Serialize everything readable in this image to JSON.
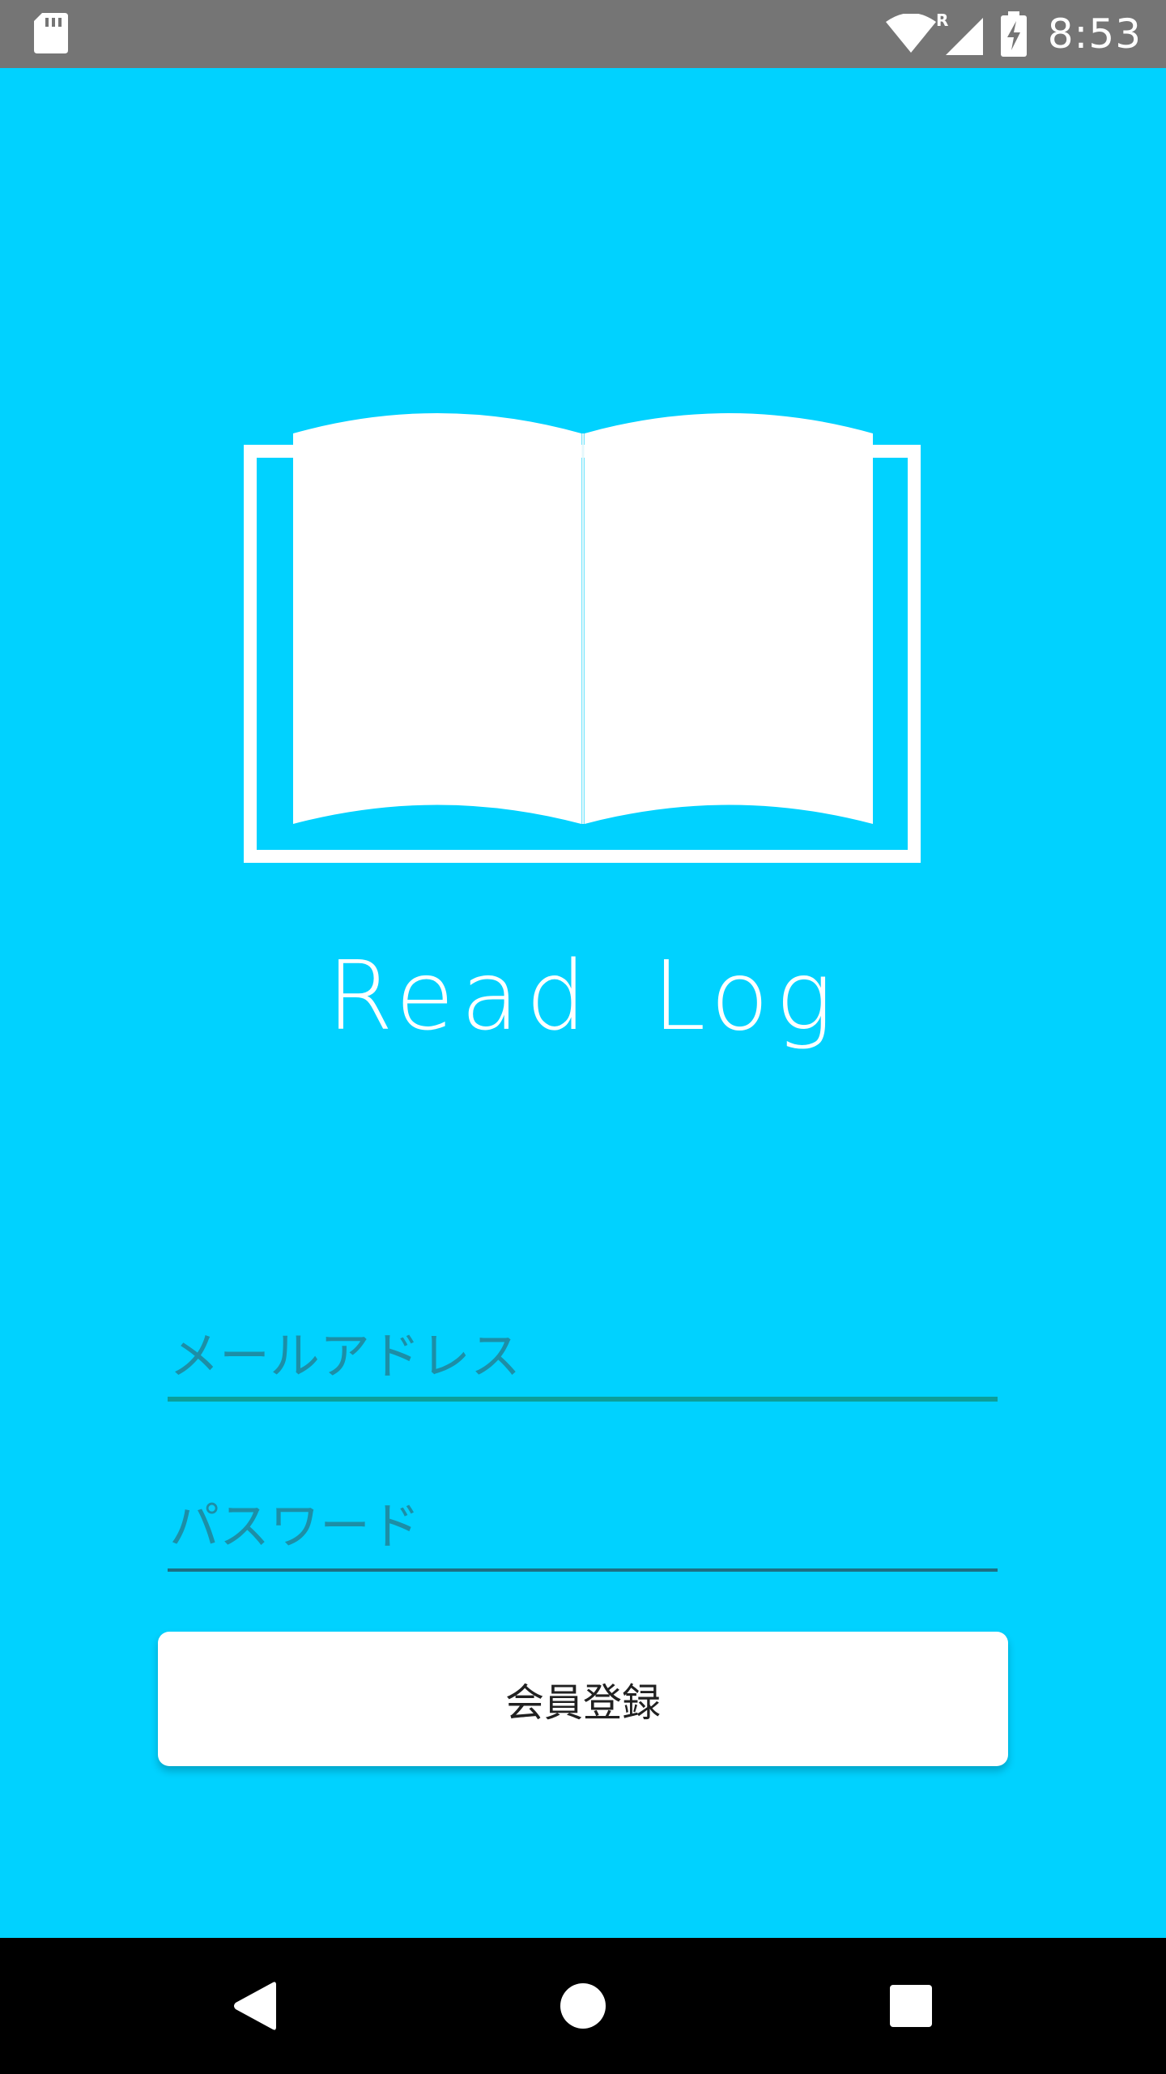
{
  "status_bar": {
    "time": "8:53",
    "roaming_label": "R",
    "icons": [
      "sd-card-icon",
      "wifi-icon",
      "cellular-signal-icon",
      "battery-charging-icon"
    ]
  },
  "app": {
    "title": "Read Log",
    "logo_icon": "open-book-icon"
  },
  "form": {
    "email_placeholder": "メールアドレス",
    "email_value": "",
    "password_placeholder": "パスワード",
    "password_value": "",
    "register_label": "会員登録"
  },
  "nav_bar": {
    "icons": [
      "back-icon",
      "home-icon",
      "recents-icon"
    ]
  },
  "colors": {
    "background": "#00d2ff",
    "status_bar": "#757575",
    "nav_bar": "#000000",
    "email_underline": "#0c9e9a",
    "password_underline": "#1d6f84",
    "button": "#ffffff"
  }
}
